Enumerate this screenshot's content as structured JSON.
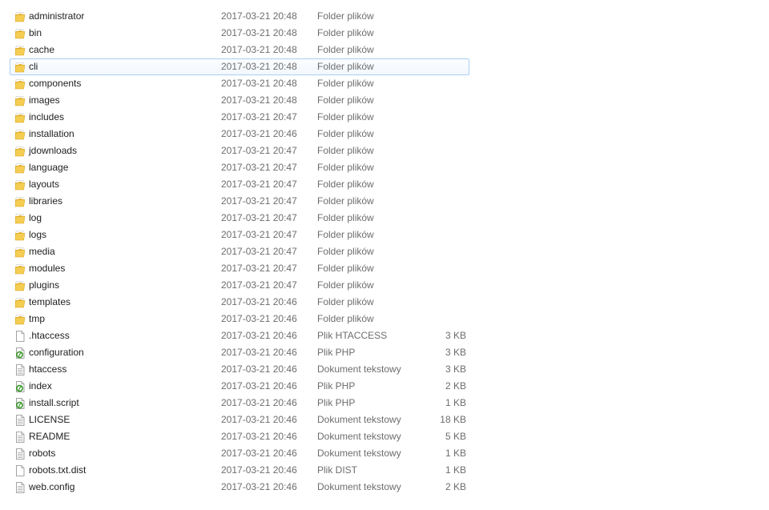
{
  "files": [
    {
      "name": "administrator",
      "date": "2017-03-21 20:48",
      "type": "Folder plików",
      "size": "",
      "icon": "folder-icon"
    },
    {
      "name": "bin",
      "date": "2017-03-21 20:48",
      "type": "Folder plików",
      "size": "",
      "icon": "folder-icon"
    },
    {
      "name": "cache",
      "date": "2017-03-21 20:48",
      "type": "Folder plików",
      "size": "",
      "icon": "folder-icon"
    },
    {
      "name": "cli",
      "date": "2017-03-21 20:48",
      "type": "Folder plików",
      "size": "",
      "icon": "folder-icon",
      "selected": true
    },
    {
      "name": "components",
      "date": "2017-03-21 20:48",
      "type": "Folder plików",
      "size": "",
      "icon": "folder-icon"
    },
    {
      "name": "images",
      "date": "2017-03-21 20:48",
      "type": "Folder plików",
      "size": "",
      "icon": "folder-icon"
    },
    {
      "name": "includes",
      "date": "2017-03-21 20:47",
      "type": "Folder plików",
      "size": "",
      "icon": "folder-icon"
    },
    {
      "name": "installation",
      "date": "2017-03-21 20:46",
      "type": "Folder plików",
      "size": "",
      "icon": "folder-icon"
    },
    {
      "name": "jdownloads",
      "date": "2017-03-21 20:47",
      "type": "Folder plików",
      "size": "",
      "icon": "folder-icon"
    },
    {
      "name": "language",
      "date": "2017-03-21 20:47",
      "type": "Folder plików",
      "size": "",
      "icon": "folder-icon"
    },
    {
      "name": "layouts",
      "date": "2017-03-21 20:47",
      "type": "Folder plików",
      "size": "",
      "icon": "folder-icon"
    },
    {
      "name": "libraries",
      "date": "2017-03-21 20:47",
      "type": "Folder plików",
      "size": "",
      "icon": "folder-icon"
    },
    {
      "name": "log",
      "date": "2017-03-21 20:47",
      "type": "Folder plików",
      "size": "",
      "icon": "folder-icon"
    },
    {
      "name": "logs",
      "date": "2017-03-21 20:47",
      "type": "Folder plików",
      "size": "",
      "icon": "folder-icon"
    },
    {
      "name": "media",
      "date": "2017-03-21 20:47",
      "type": "Folder plików",
      "size": "",
      "icon": "folder-icon"
    },
    {
      "name": "modules",
      "date": "2017-03-21 20:47",
      "type": "Folder plików",
      "size": "",
      "icon": "folder-icon"
    },
    {
      "name": "plugins",
      "date": "2017-03-21 20:47",
      "type": "Folder plików",
      "size": "",
      "icon": "folder-icon"
    },
    {
      "name": "templates",
      "date": "2017-03-21 20:46",
      "type": "Folder plików",
      "size": "",
      "icon": "folder-icon"
    },
    {
      "name": "tmp",
      "date": "2017-03-21 20:46",
      "type": "Folder plików",
      "size": "",
      "icon": "folder-icon"
    },
    {
      "name": ".htaccess",
      "date": "2017-03-21 20:46",
      "type": "Plik HTACCESS",
      "size": "3 KB",
      "icon": "blank-file-icon"
    },
    {
      "name": "configuration",
      "date": "2017-03-21 20:46",
      "type": "Plik PHP",
      "size": "3 KB",
      "icon": "php-file-icon"
    },
    {
      "name": "htaccess",
      "date": "2017-03-21 20:46",
      "type": "Dokument tekstowy",
      "size": "3 KB",
      "icon": "text-file-icon"
    },
    {
      "name": "index",
      "date": "2017-03-21 20:46",
      "type": "Plik PHP",
      "size": "2 KB",
      "icon": "php-file-icon"
    },
    {
      "name": "install.script",
      "date": "2017-03-21 20:46",
      "type": "Plik PHP",
      "size": "1 KB",
      "icon": "php-file-icon"
    },
    {
      "name": "LICENSE",
      "date": "2017-03-21 20:46",
      "type": "Dokument tekstowy",
      "size": "18 KB",
      "icon": "text-file-icon"
    },
    {
      "name": "README",
      "date": "2017-03-21 20:46",
      "type": "Dokument tekstowy",
      "size": "5 KB",
      "icon": "text-file-icon"
    },
    {
      "name": "robots",
      "date": "2017-03-21 20:46",
      "type": "Dokument tekstowy",
      "size": "1 KB",
      "icon": "text-file-icon"
    },
    {
      "name": "robots.txt.dist",
      "date": "2017-03-21 20:46",
      "type": "Plik DIST",
      "size": "1 KB",
      "icon": "blank-file-icon"
    },
    {
      "name": "web.config",
      "date": "2017-03-21 20:46",
      "type": "Dokument tekstowy",
      "size": "2 KB",
      "icon": "text-file-icon"
    }
  ],
  "colors": {
    "selection_border": "#a8d0f5",
    "folder_yellow": "#f0c43c",
    "php_green": "#3a9a2a",
    "secondary_text": "#6d6d6d"
  }
}
